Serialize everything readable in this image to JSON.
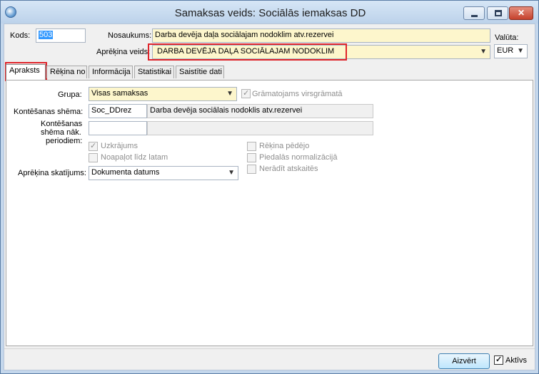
{
  "window": {
    "title": "Samaksas veids: Sociālās iemaksas DD",
    "controls": {
      "minimize": "—",
      "maximize": "□",
      "close": "✕"
    }
  },
  "header": {
    "kods_label": "Kods:",
    "kods_value": "503",
    "nosaukums_label": "Nosaukums:",
    "nosaukums_value": "Darba devēja daļa sociālajam nodoklim atv.rezervei",
    "aprekina_veids_label": "Aprēķina veids:",
    "aprekina_veids_value": "DARBA DEVĒJA DAĻA SOCIĀLAJAM NODOKLIM",
    "valuta_label": "Valūta:",
    "valuta_value": "EUR"
  },
  "tabs": [
    {
      "label": "Apraksts",
      "active": true
    },
    {
      "label": "Rēķina no",
      "active": false
    },
    {
      "label": "Informācija",
      "active": false
    },
    {
      "label": "Statistikai",
      "active": false
    },
    {
      "label": "Saistītie dati",
      "active": false
    }
  ],
  "form": {
    "grupa_label": "Grupa:",
    "grupa_value": "Visas samaksas",
    "gramatojams_label": "Grāmatojams virsgrāmatā",
    "gramatojams_checked": true,
    "kontesanas_shema_label": "Kontēšanas shēma:",
    "kontesanas_shema_code": "Soc_DDrez",
    "kontesanas_shema_name": "Darba devēja sociālais nodoklis atv.rezervei",
    "kontesanas_nak_label_1": "Kontēšanas",
    "kontesanas_nak_label_2": "shēma nāk.",
    "kontesanas_nak_label_3": "periodiem:",
    "kontesanas_nak_code": "",
    "kontesanas_nak_name": "",
    "uzkrajums_label": "Uzkrājums",
    "uzkrajums_checked": true,
    "noapalot_label": "Noapaļot līdz latam",
    "noapalot_checked": false,
    "rekina_pedejo_label": "Rēķina pēdējo",
    "rekina_pedejo_checked": false,
    "piedalas_label": "Piedalās normalizācijā",
    "piedalas_checked": false,
    "neradit_label": "Nerādīt atskaitēs",
    "neradit_checked": false,
    "skatijums_label": "Aprēķina skatījums:",
    "skatijums_value": "Dokumenta datums"
  },
  "footer": {
    "close_label": "Aizvērt",
    "aktivs_label": "Aktīvs",
    "aktivs_checked": true
  },
  "icons": {
    "app": "globe-icon",
    "dropdown": "chevron-down-icon"
  },
  "colors": {
    "highlight_box": "#e0242b",
    "required_field": "#fdf6cc",
    "selection": "#3399ff"
  }
}
